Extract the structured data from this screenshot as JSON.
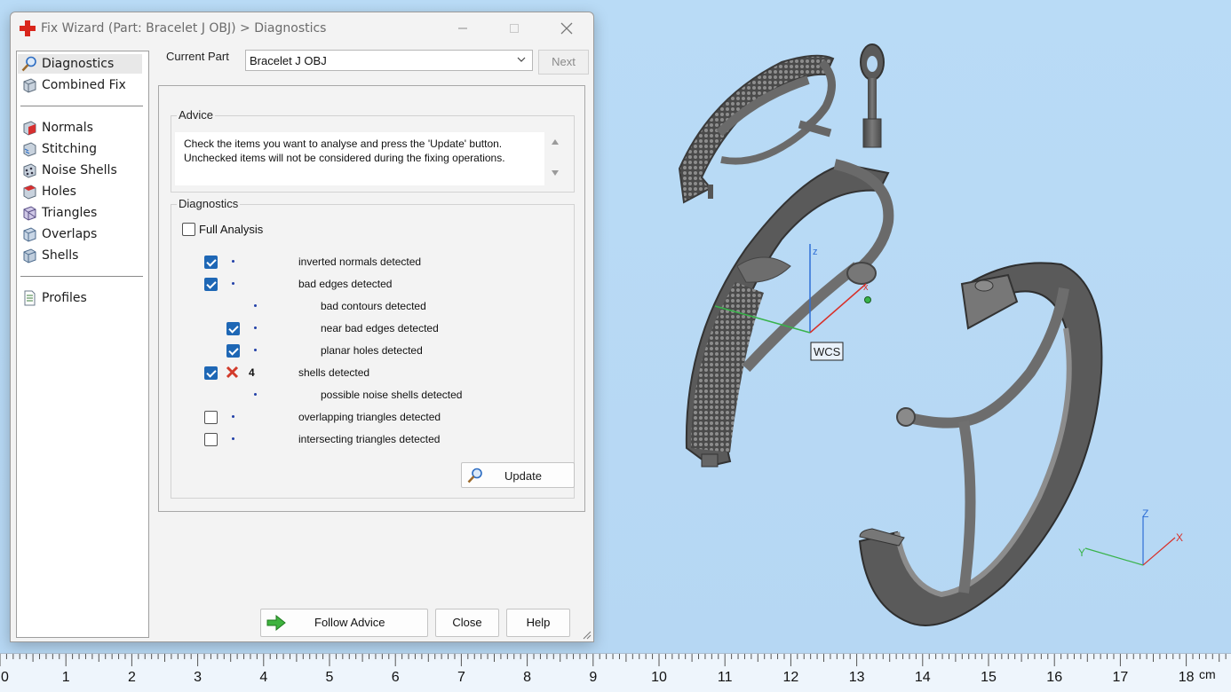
{
  "window": {
    "title": "Fix Wizard (Part: Bracelet J OBJ) > Diagnostics"
  },
  "nav": {
    "items": [
      {
        "label": "Diagnostics",
        "icon": "magnifier-icon",
        "selected": true
      },
      {
        "label": "Combined Fix",
        "icon": "combined-fix-icon"
      },
      {
        "label": "Normals",
        "icon": "normals-icon"
      },
      {
        "label": "Stitching",
        "icon": "stitching-icon"
      },
      {
        "label": "Noise Shells",
        "icon": "noise-shells-icon"
      },
      {
        "label": "Holes",
        "icon": "holes-icon"
      },
      {
        "label": "Triangles",
        "icon": "triangles-icon"
      },
      {
        "label": "Overlaps",
        "icon": "overlaps-icon"
      },
      {
        "label": "Shells",
        "icon": "shells-icon"
      },
      {
        "label": "Profiles",
        "icon": "profiles-icon"
      }
    ]
  },
  "part": {
    "label": "Current Part",
    "value": "Bracelet J OBJ",
    "next_label": "Next"
  },
  "advice": {
    "title": "Advice",
    "text_line1": "Check the items you want to analyse and press the 'Update' button.",
    "text_line2": "Unchecked items will not be considered during the fixing operations."
  },
  "diagnostics": {
    "title": "Diagnostics",
    "full_analysis_label": "Full Analysis",
    "full_analysis_checked": false,
    "items": [
      {
        "label": "inverted normals detected",
        "checked": true
      },
      {
        "label": "bad edges detected",
        "checked": true
      },
      {
        "label": "bad contours detected",
        "checked": null
      },
      {
        "label": "near bad edges detected",
        "checked": true
      },
      {
        "label": "planar holes detected",
        "checked": true
      },
      {
        "label": "shells detected",
        "checked": true,
        "status": "error",
        "count": "4"
      },
      {
        "label": "possible noise shells detected",
        "checked": null
      },
      {
        "label": "overlapping triangles detected",
        "checked": false
      },
      {
        "label": "intersecting triangles detected",
        "checked": false
      }
    ],
    "update_label": "Update"
  },
  "footer": {
    "follow_advice": "Follow Advice",
    "close": "Close",
    "help": "Help"
  },
  "viewport": {
    "wcs_label": "WCS",
    "axis_z": "Z",
    "axis_x": "X",
    "axis_y": "Y",
    "wcs_axis_z": "z",
    "wcs_axis_x": "x"
  },
  "ruler": {
    "unit": "cm",
    "numbers": [
      "0",
      "1",
      "2",
      "3",
      "4",
      "5",
      "6",
      "7",
      "8",
      "9",
      "10",
      "11",
      "12",
      "13",
      "14",
      "15",
      "16",
      "17",
      "18"
    ]
  },
  "colors": {
    "background": "#b8d8f4",
    "selection_blue": "#1e67b5",
    "error_red": "#d23a2a",
    "axis_red": "#d8312a",
    "axis_green": "#38b34a",
    "axis_blue": "#2f6fd6",
    "model_gray": "#5e5e5e"
  }
}
